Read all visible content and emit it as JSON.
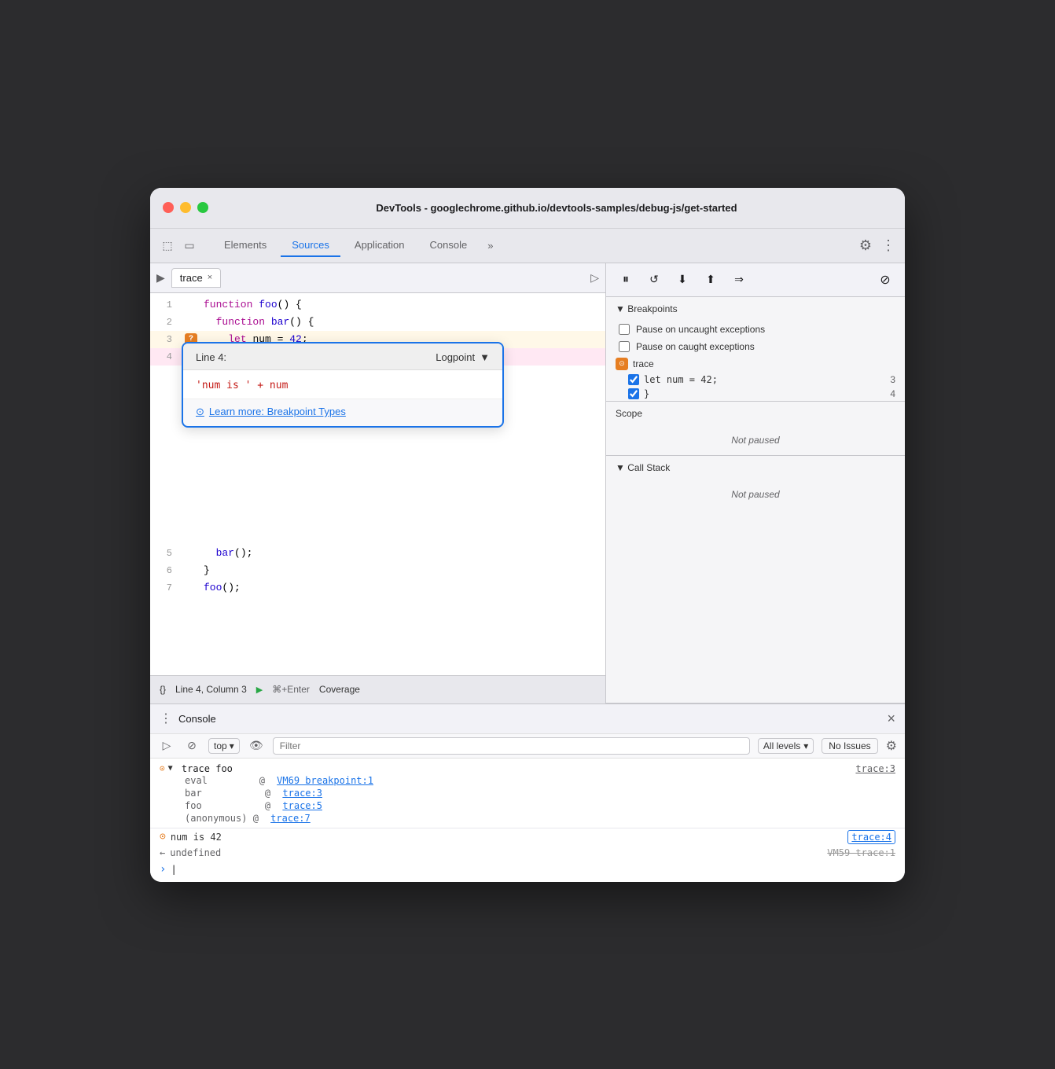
{
  "window": {
    "title": "DevTools - googlechrome.github.io/devtools-samples/debug-js/get-started",
    "traffic_lights": [
      "red",
      "yellow",
      "green"
    ]
  },
  "tabs": {
    "items": [
      "Elements",
      "Sources",
      "Application",
      "Console"
    ],
    "active": "Sources",
    "more_label": "»"
  },
  "file_panel": {
    "icon": "▶",
    "current_file": "trace",
    "close_icon": "×"
  },
  "code": {
    "lines": [
      {
        "num": 1,
        "content": "function foo() {",
        "gutter": ""
      },
      {
        "num": 2,
        "content": "  function bar() {",
        "gutter": ""
      },
      {
        "num": 3,
        "content": "    let num = 42;",
        "gutter": "?",
        "gutter_color": "orange"
      },
      {
        "num": 4,
        "content": "  }",
        "gutter": "·",
        "gutter_color": "pink"
      },
      {
        "num": 5,
        "content": "  bar();",
        "gutter": ""
      },
      {
        "num": 6,
        "content": "}",
        "gutter": ""
      },
      {
        "num": 7,
        "content": "foo();",
        "gutter": ""
      }
    ]
  },
  "logpoint": {
    "header_line": "Line 4:",
    "type": "Logpoint",
    "dropdown_arrow": "▼",
    "input_value": "'num is ' + num",
    "link_text": "Learn more: Breakpoint Types",
    "link_icon": "⊙"
  },
  "status_bar": {
    "icon": "{}",
    "position": "Line 4, Column 3",
    "run_icon": "▶",
    "shortcut": "⌘+Enter",
    "coverage": "Coverage"
  },
  "debug_toolbar": {
    "pause_icon": "⏸",
    "refresh_icon": "↺",
    "step_over": "⤵",
    "step_into": "↑",
    "step_out": "⇒",
    "deactivate": "⊘"
  },
  "breakpoints": {
    "section_title": "▼ Breakpoints",
    "pause_uncaught": "Pause on uncaught exceptions",
    "pause_caught": "Pause on caught exceptions",
    "file": "trace",
    "items": [
      {
        "checked": true,
        "code": "let num = 42;",
        "line": "3"
      },
      {
        "checked": true,
        "code": "}",
        "line": "4"
      }
    ]
  },
  "scope": {
    "section_title": "Scope",
    "not_paused": "Not paused"
  },
  "callstack": {
    "section_title": "▼ Call Stack",
    "not_paused": "Not paused"
  },
  "console": {
    "title": "Console",
    "close_icon": "×",
    "filter_placeholder": "Filter",
    "levels_label": "All levels",
    "issues_label": "No Issues",
    "top_label": "top",
    "eye_icon": "👁",
    "block_icon": "⊘",
    "trace_group": {
      "label": "▼ trace foo",
      "link": "trace:3",
      "entries": [
        {
          "label": "eval",
          "at": "@ ",
          "link": "VM69 breakpoint:1"
        },
        {
          "label": "bar",
          "at": "@ ",
          "link": "trace:3"
        },
        {
          "label": "foo",
          "at": "@ ",
          "link": "trace:5"
        },
        {
          "label": "(anonymous)",
          "at": "@ ",
          "link": "trace:7"
        }
      ]
    },
    "output": {
      "icon": "⊙",
      "text": "num is 42",
      "link": "trace:4",
      "link_highlighted": true
    },
    "undefined_line": {
      "icon": "←",
      "text": "undefined",
      "link": "VM59 trace:1"
    },
    "prompt": ">"
  }
}
